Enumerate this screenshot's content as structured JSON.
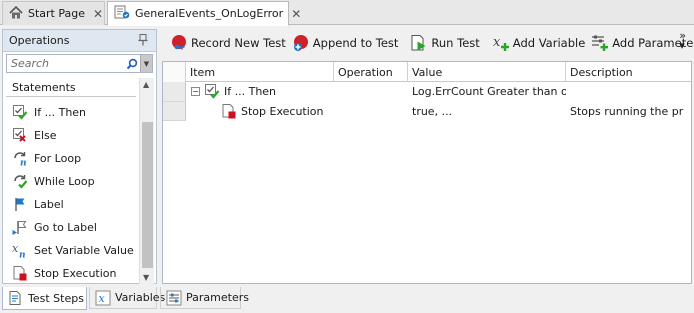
{
  "tabs": [
    {
      "label": "Start Page",
      "icon": "home-icon",
      "active": false
    },
    {
      "label": "GeneralEvents_OnLogError",
      "icon": "test-icon",
      "active": true
    }
  ],
  "tab_close_glyph": "✕",
  "operations_panel": {
    "title": "Operations",
    "search_placeholder": "Search",
    "section": "Statements",
    "items": [
      {
        "label": "If ... Then",
        "icon": "check-ok-icon"
      },
      {
        "label": "Else",
        "icon": "check-x-icon"
      },
      {
        "label": "For Loop",
        "icon": "for-loop-icon"
      },
      {
        "label": "While Loop",
        "icon": "while-loop-icon"
      },
      {
        "label": "Label",
        "icon": "flag-icon"
      },
      {
        "label": "Go to Label",
        "icon": "goto-flag-icon"
      },
      {
        "label": "Set Variable Value",
        "icon": "set-variable-icon"
      },
      {
        "label": "Stop Execution",
        "icon": "stop-execution-icon"
      }
    ]
  },
  "toolbar": {
    "record_new_test": "Record New Test",
    "append_to_test": "Append to Test",
    "run_test": "Run Test",
    "add_variable": "Add Variable",
    "add_parameter": "Add Parameter",
    "overflow": "»"
  },
  "grid": {
    "columns": [
      "Item",
      "Operation",
      "Value",
      "Description"
    ],
    "rows": [
      {
        "item": "If ... Then",
        "operation": "",
        "value": "Log.ErrCount Greater than or...",
        "description": ""
      },
      {
        "item": "Stop Execution",
        "operation": "",
        "value": "true, ...",
        "description": "Stops running the pr"
      }
    ]
  },
  "bottom_tabs": [
    {
      "label": "Test Steps",
      "active": true
    },
    {
      "label": "Variables",
      "active": false
    },
    {
      "label": "Parameters",
      "active": false
    }
  ],
  "colors": {
    "panel_header": "#dfe7f1",
    "record_red": "#d0202a",
    "check_green": "#2aa52a",
    "stop_red": "#cc1020",
    "variable_blue": "#1f78c8"
  }
}
